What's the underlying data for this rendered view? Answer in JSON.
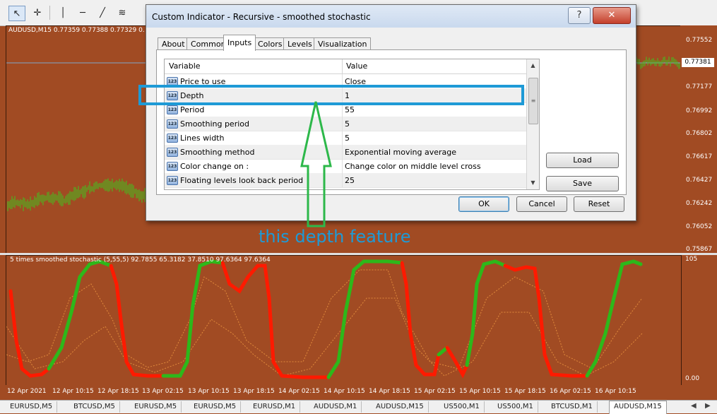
{
  "toolbar": {
    "tools": [
      {
        "name": "cursor-tool",
        "icon": "cursor-icon",
        "glyph": "↖"
      },
      {
        "name": "crosshair-tool",
        "icon": "crosshair-icon",
        "glyph": "✛"
      },
      {
        "name": "vertical-line-tool",
        "icon": "vertical-line-icon",
        "glyph": "│"
      },
      {
        "name": "horizontal-line-tool",
        "icon": "horizontal-line-icon",
        "glyph": "─"
      },
      {
        "name": "trendline-tool",
        "icon": "trendline-icon",
        "glyph": "╱"
      },
      {
        "name": "fibonacci-tool",
        "icon": "fibonacci-icon",
        "glyph": "≋"
      }
    ]
  },
  "main_chart": {
    "title": "AUDUSD,M15  0.77359 0.77388 0.77329 0.",
    "price_labels": [
      "0.77552",
      "0.77177",
      "0.76992",
      "0.76802",
      "0.76617",
      "0.76427",
      "0.76242",
      "0.76052",
      "0.75867"
    ],
    "current_price": "0.77381"
  },
  "sub_chart": {
    "title": "5 times smoothed stochastic (5,55,5) 92.7855 65.3182 37.8510 97.6364 97.6364",
    "axis_top": "105",
    "axis_bottom": "0.00",
    "colors": {
      "up": "#2db81a",
      "down": "#ff1a00",
      "levels": "#e08a3c"
    }
  },
  "time_axis": [
    "12 Apr 2021",
    "12 Apr 10:15",
    "12 Apr 18:15",
    "13 Apr 02:15",
    "13 Apr 10:15",
    "13 Apr 18:15",
    "14 Apr 02:15",
    "14 Apr 10:15",
    "14 Apr 18:15",
    "15 Apr 02:15",
    "15 Apr 10:15",
    "15 Apr 18:15",
    "16 Apr 02:15",
    "16 Apr 10:15"
  ],
  "symbol_tabs": [
    "EURUSD,M5",
    "BTCUSD,M5",
    "EURUSD,M5",
    "EURUSD,M5",
    "EURUSD,M1",
    "AUDUSD,M1",
    "AUDUSD,M15",
    "US500,M1",
    "US500,M1",
    "BTCUSD,M1",
    "AUDUSD,M15"
  ],
  "active_symbol_tab": 10,
  "dialog": {
    "title": "Custom Indicator - Recursive - smoothed stochastic",
    "help_glyph": "?",
    "close_glyph": "✕",
    "tabs": [
      "About",
      "Common",
      "Inputs",
      "Colors",
      "Levels",
      "Visualization"
    ],
    "active_tab": 2,
    "grid": {
      "header_variable": "Variable",
      "header_value": "Value",
      "icon_text": "123",
      "rows": [
        {
          "variable": "Price to use",
          "value": "Close"
        },
        {
          "variable": "Depth",
          "value": "1"
        },
        {
          "variable": "Period",
          "value": "55"
        },
        {
          "variable": "Smoothing period",
          "value": "5"
        },
        {
          "variable": "Lines width",
          "value": "5"
        },
        {
          "variable": "Smoothing method",
          "value": "Exponential moving average"
        },
        {
          "variable": "Color change on :",
          "value": "Change color on middle level cross"
        },
        {
          "variable": "Floating levels look back period",
          "value": "25"
        }
      ]
    },
    "buttons": {
      "load": "Load",
      "save": "Save",
      "ok": "OK",
      "cancel": "Cancel",
      "reset": "Reset"
    }
  },
  "annotation": {
    "text": "this depth feature",
    "color": "#1e9ad6"
  }
}
